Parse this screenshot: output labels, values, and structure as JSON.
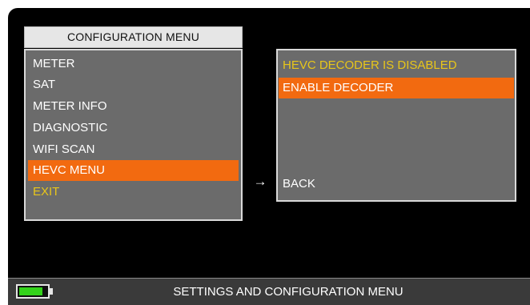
{
  "colors": {
    "screen_background": "#000000",
    "menu_background": "#6b6b6b",
    "title_background": "#e6e6e6",
    "selected": "#f26a10",
    "highlight_text": "#e8c61a",
    "battery": "#33d21a",
    "status_bar": "#3a3a3a"
  },
  "config_menu": {
    "title": "CONFIGURATION MENU",
    "items": [
      {
        "label": "METER"
      },
      {
        "label": "SAT"
      },
      {
        "label": "METER INFO"
      },
      {
        "label": "DIAGNOSTIC"
      },
      {
        "label": "WIFI SCAN"
      },
      {
        "label": "HEVC MENU"
      },
      {
        "label": "EXIT"
      }
    ],
    "selected_item": "HEVC MENU"
  },
  "submenu_arrow": "→",
  "hevc_menu": {
    "status": "HEVC DECODER IS DISABLED",
    "items": [
      {
        "label": "ENABLE DECODER"
      },
      {
        "label": "BACK"
      }
    ],
    "selected_item": "ENABLE DECODER"
  },
  "status_bar": {
    "battery_icon": "battery-icon",
    "battery_level_percent": 85,
    "text": "SETTINGS AND CONFIGURATION MENU"
  }
}
